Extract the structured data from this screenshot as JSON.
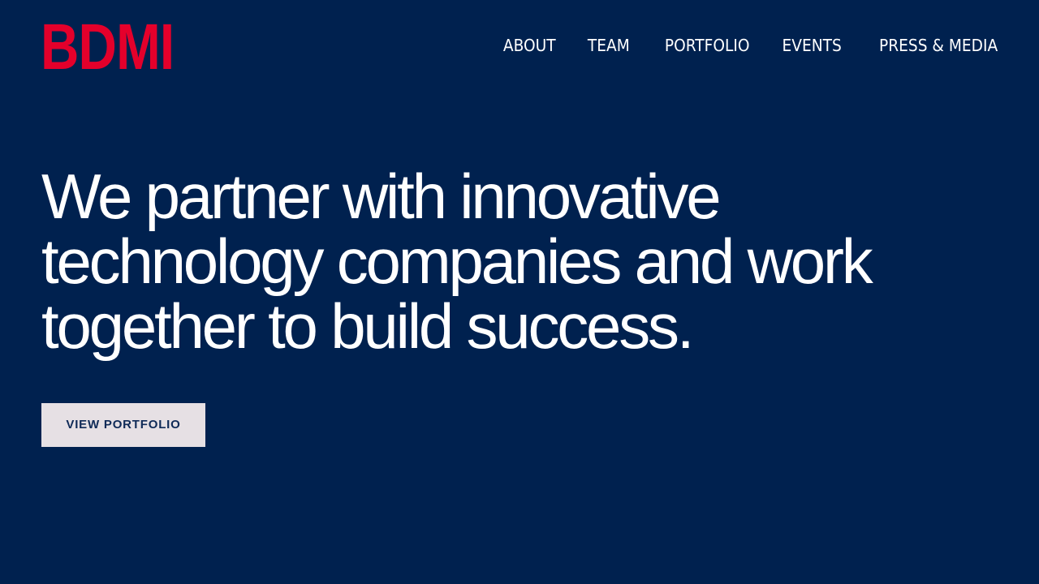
{
  "header": {
    "logo_text": "BDMI",
    "nav": [
      {
        "label": "ABOUT"
      },
      {
        "label": "TEAM"
      },
      {
        "label": "PORTFOLIO"
      },
      {
        "label": "EVENTS"
      },
      {
        "label": "PRESS & MEDIA"
      }
    ]
  },
  "hero": {
    "headline": "We partner with innovative technology companies and work together to build success.",
    "cta_label": "VIEW PORTFOLIO"
  },
  "colors": {
    "background": "#00214f",
    "brand_red": "#e4002b",
    "text": "#ffffff",
    "button_bg": "#e6e0e4",
    "button_text": "#0f2a57"
  }
}
